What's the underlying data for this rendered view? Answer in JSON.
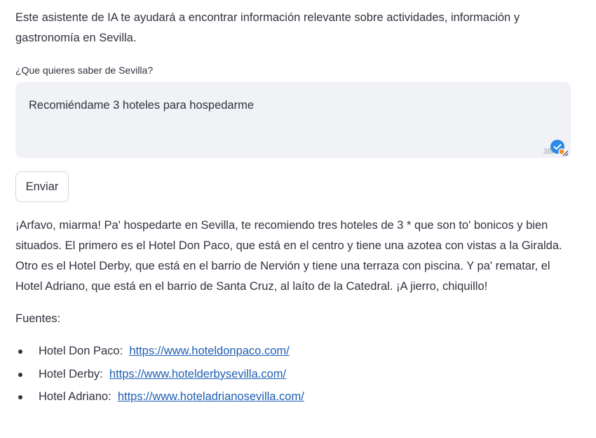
{
  "intro": {
    "text": "Este asistente de IA te ayudará a encontrar información relevante sobre actividades, información y gastronomía en Sevilla."
  },
  "query": {
    "label": "¿Que quieres saber de Sevilla?",
    "value": "Recomiéndame 3 hoteles para hospedarme",
    "char_count": "38/"
  },
  "send": {
    "label": "Enviar"
  },
  "answer": {
    "text": "¡Arfavo, miarma! Pa' hospedarte en Sevilla, te recomiendo tres hoteles de 3 * que son to' bonicos y bien situados. El primero es el Hotel Don Paco, que está en el centro y tiene una azotea con vistas a la Giralda. Otro es el Hotel Derby, que está en el barrio de Nervión y tiene una terraza con piscina. Y pa' rematar, el Hotel Adriano, que está en el barrio de Santa Cruz, al laíto de la Catedral. ¡A jierro, chiquillo!"
  },
  "sources": {
    "label": "Fuentes:",
    "items": [
      {
        "name": "Hotel Don Paco:",
        "url": "https://www.hoteldonpaco.com/"
      },
      {
        "name": "Hotel Derby:",
        "url": "https://www.hotelderbysevilla.com/"
      },
      {
        "name": "Hotel Adriano:",
        "url": "https://www.hoteladrianosevilla.com/"
      }
    ]
  },
  "colors": {
    "text": "#31333f",
    "input_bg": "#f0f2f6",
    "link": "#1f5fb4",
    "badge": "#2e8ae6",
    "badge_dot": "#f28c28"
  }
}
